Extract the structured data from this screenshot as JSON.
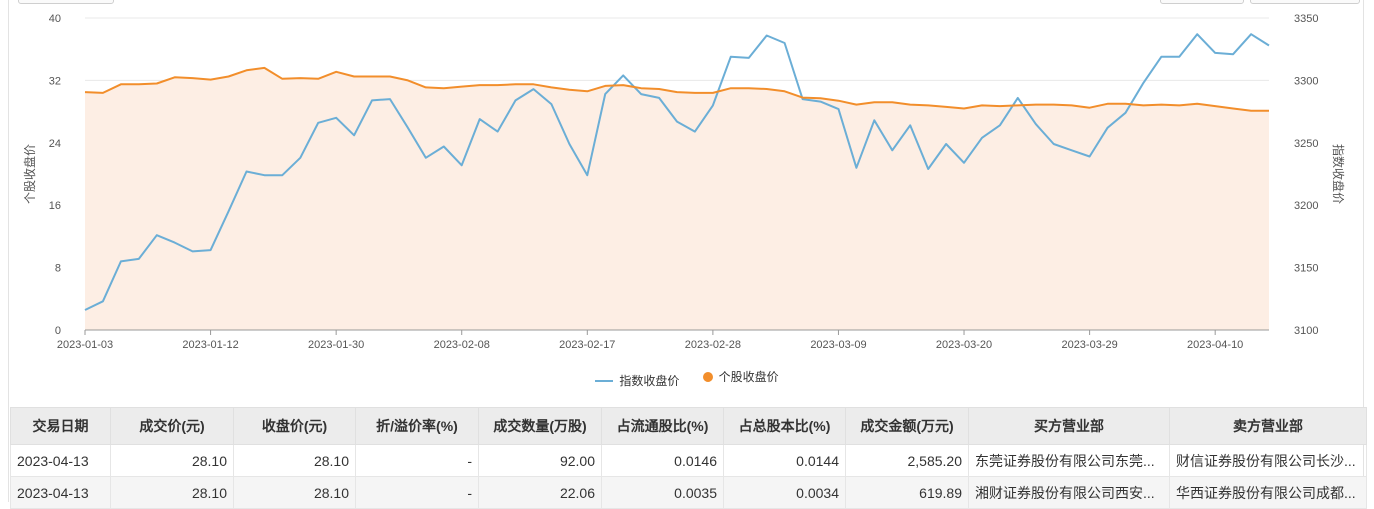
{
  "chart_data": {
    "type": "line",
    "x": [
      "2023-01-03",
      "2023-01-04",
      "2023-01-05",
      "2023-01-06",
      "2023-01-09",
      "2023-01-10",
      "2023-01-11",
      "2023-01-12",
      "2023-01-13",
      "2023-01-16",
      "2023-01-17",
      "2023-01-18",
      "2023-01-19",
      "2023-01-20",
      "2023-01-30",
      "2023-01-31",
      "2023-02-01",
      "2023-02-02",
      "2023-02-03",
      "2023-02-06",
      "2023-02-07",
      "2023-02-08",
      "2023-02-09",
      "2023-02-10",
      "2023-02-13",
      "2023-02-14",
      "2023-02-15",
      "2023-02-16",
      "2023-02-17",
      "2023-02-20",
      "2023-02-21",
      "2023-02-22",
      "2023-02-23",
      "2023-02-24",
      "2023-02-27",
      "2023-02-28",
      "2023-03-01",
      "2023-03-02",
      "2023-03-03",
      "2023-03-06",
      "2023-03-07",
      "2023-03-08",
      "2023-03-09",
      "2023-03-10",
      "2023-03-13",
      "2023-03-14",
      "2023-03-15",
      "2023-03-16",
      "2023-03-17",
      "2023-03-20",
      "2023-03-21",
      "2023-03-22",
      "2023-03-23",
      "2023-03-24",
      "2023-03-27",
      "2023-03-28",
      "2023-03-29",
      "2023-03-30",
      "2023-03-31",
      "2023-04-03",
      "2023-04-04",
      "2023-04-06",
      "2023-04-07",
      "2023-04-10",
      "2023-04-11",
      "2023-04-12",
      "2023-04-13"
    ],
    "x_tick_labels": [
      "2023-01-03",
      "2023-01-12",
      "2023-01-30",
      "2023-02-08",
      "2023-02-17",
      "2023-02-28",
      "2023-03-09",
      "2023-03-20",
      "2023-03-29",
      "2023-04-10"
    ],
    "x_tick_indices": [
      0,
      7,
      14,
      21,
      28,
      35,
      42,
      49,
      56,
      63
    ],
    "series": [
      {
        "name": "指数收盘价",
        "axis": "right",
        "color": "#6baed6",
        "values": [
          3116,
          3123,
          3155,
          3157,
          3176,
          3170,
          3163,
          3164,
          3195,
          3227,
          3224,
          3224,
          3238,
          3266,
          3270,
          3256,
          3284,
          3285,
          3262,
          3238,
          3247,
          3232,
          3269,
          3259,
          3284,
          3293,
          3281,
          3249,
          3224,
          3289,
          3304,
          3289,
          3286,
          3267,
          3259,
          3280,
          3319,
          3318,
          3336,
          3330,
          3285,
          3283,
          3277,
          3230,
          3268,
          3244,
          3264,
          3229,
          3249,
          3234,
          3254,
          3264,
          3286,
          3265,
          3249,
          3244,
          3239,
          3262,
          3274,
          3298,
          3319,
          3319,
          3337,
          3322,
          3321,
          3337,
          3328
        ]
      },
      {
        "name": "个股收盘价",
        "axis": "left",
        "color": "#f28e2b",
        "values": [
          30.5,
          30.4,
          31.5,
          31.5,
          31.6,
          32.4,
          32.3,
          32.1,
          32.5,
          33.3,
          33.6,
          32.2,
          32.3,
          32.2,
          33.1,
          32.5,
          32.5,
          32.5,
          32.0,
          31.1,
          31.0,
          31.2,
          31.4,
          31.4,
          31.5,
          31.5,
          31.1,
          30.8,
          30.6,
          31.3,
          31.4,
          31.0,
          30.9,
          30.5,
          30.4,
          30.4,
          31.0,
          31.0,
          30.9,
          30.6,
          29.8,
          29.7,
          29.4,
          28.9,
          29.2,
          29.2,
          28.9,
          28.8,
          28.6,
          28.4,
          28.8,
          28.7,
          28.8,
          28.9,
          28.9,
          28.8,
          28.5,
          29.0,
          29.0,
          28.8,
          28.9,
          28.8,
          29.0,
          28.7,
          28.4,
          28.1,
          28.1
        ]
      }
    ],
    "ylabel_left": "个股收盘价",
    "ylabel_right": "指数收盘价",
    "ylim_left": [
      0,
      40
    ],
    "yticks_left": [
      0,
      8,
      16,
      24,
      32,
      40
    ],
    "ylim_right": [
      3100,
      3350
    ],
    "yticks_right": [
      3100,
      3150,
      3200,
      3250,
      3300,
      3350
    ],
    "grid": true,
    "area_fill_color": "#fdeee4",
    "legend_position": "bottom"
  },
  "table": {
    "headers": [
      "交易日期",
      "成交价(元)",
      "收盘价(元)",
      "折/溢价率(%)",
      "成交数量(万股)",
      "占流通股比(%)",
      "占总股本比(%)",
      "成交金额(万元)",
      "买方营业部",
      "卖方营业部"
    ],
    "rows": [
      [
        "2023-04-13",
        "28.10",
        "28.10",
        "-",
        "92.00",
        "0.0146",
        "0.0144",
        "2,585.20",
        "东莞证券股份有限公司东莞...",
        "财信证券股份有限公司长沙..."
      ],
      [
        "2023-04-13",
        "28.10",
        "28.10",
        "-",
        "22.06",
        "0.0035",
        "0.0034",
        "619.89",
        "湘财证券股份有限公司西安...",
        "华西证券股份有限公司成都..."
      ]
    ]
  }
}
